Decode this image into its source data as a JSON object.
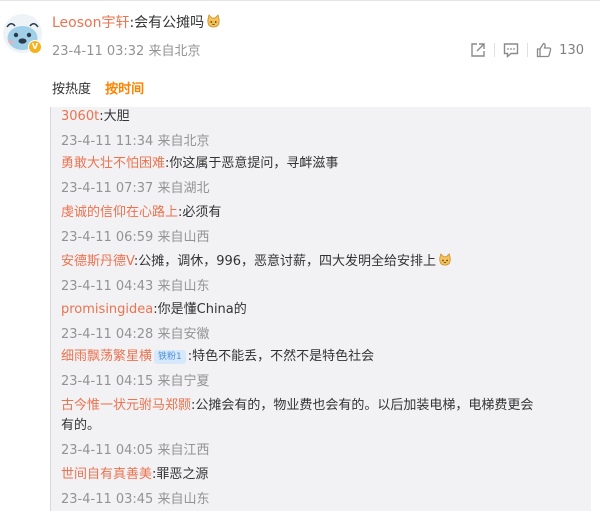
{
  "post": {
    "author": "Leoson宇轩",
    "text": ":会有公摊吗",
    "emoji_icon": "cat-emoji",
    "time": "23-4-11 03:32",
    "source": "来自北京",
    "like_count": "130",
    "icons": [
      "share-icon",
      "comment-icon",
      "like-icon"
    ]
  },
  "sort": {
    "hot": "按热度",
    "time": "按时间",
    "active": "time"
  },
  "comments": [
    {
      "user": "3060t",
      "text": ":大胆",
      "time": "23-4-11 11:34",
      "source": "来自北京"
    },
    {
      "user": "勇敢大壮不怕困难",
      "text": ":你这属于恶意提问，寻衅滋事",
      "time": "23-4-11 07:37",
      "source": "来自湖北"
    },
    {
      "user": "虔诚的信仰在心路上",
      "text": ":必须有",
      "time": "23-4-11 06:59",
      "source": "来自山西"
    },
    {
      "user": "安德斯丹德V",
      "text": ":公摊，调休，996，恶意讨薪，四大发明全给安排上",
      "time": "23-4-11 04:43",
      "source": "来自山东"
    },
    {
      "user": "promisingidea",
      "text": ":你是懂China的",
      "time": "23-4-11 04:28",
      "source": "来自安徽"
    },
    {
      "user": "细雨飘荡繁星横",
      "badge": "铁粉1",
      "text": ":特色不能丢，不然不是特色社会",
      "time": "23-4-11 04:15",
      "source": "来自宁夏"
    },
    {
      "user": "古今惟一状元驸马郑颢",
      "text": ":公摊会有的，物业费也会有的。以后加装电梯，电梯费更会",
      "text2": "有的。",
      "time": "23-4-11 04:05",
      "source": "来自江西"
    },
    {
      "user": "世间自有真善美",
      "text": ":罪恶之源",
      "time": "23-4-11 03:45",
      "source": "来自山东"
    }
  ]
}
